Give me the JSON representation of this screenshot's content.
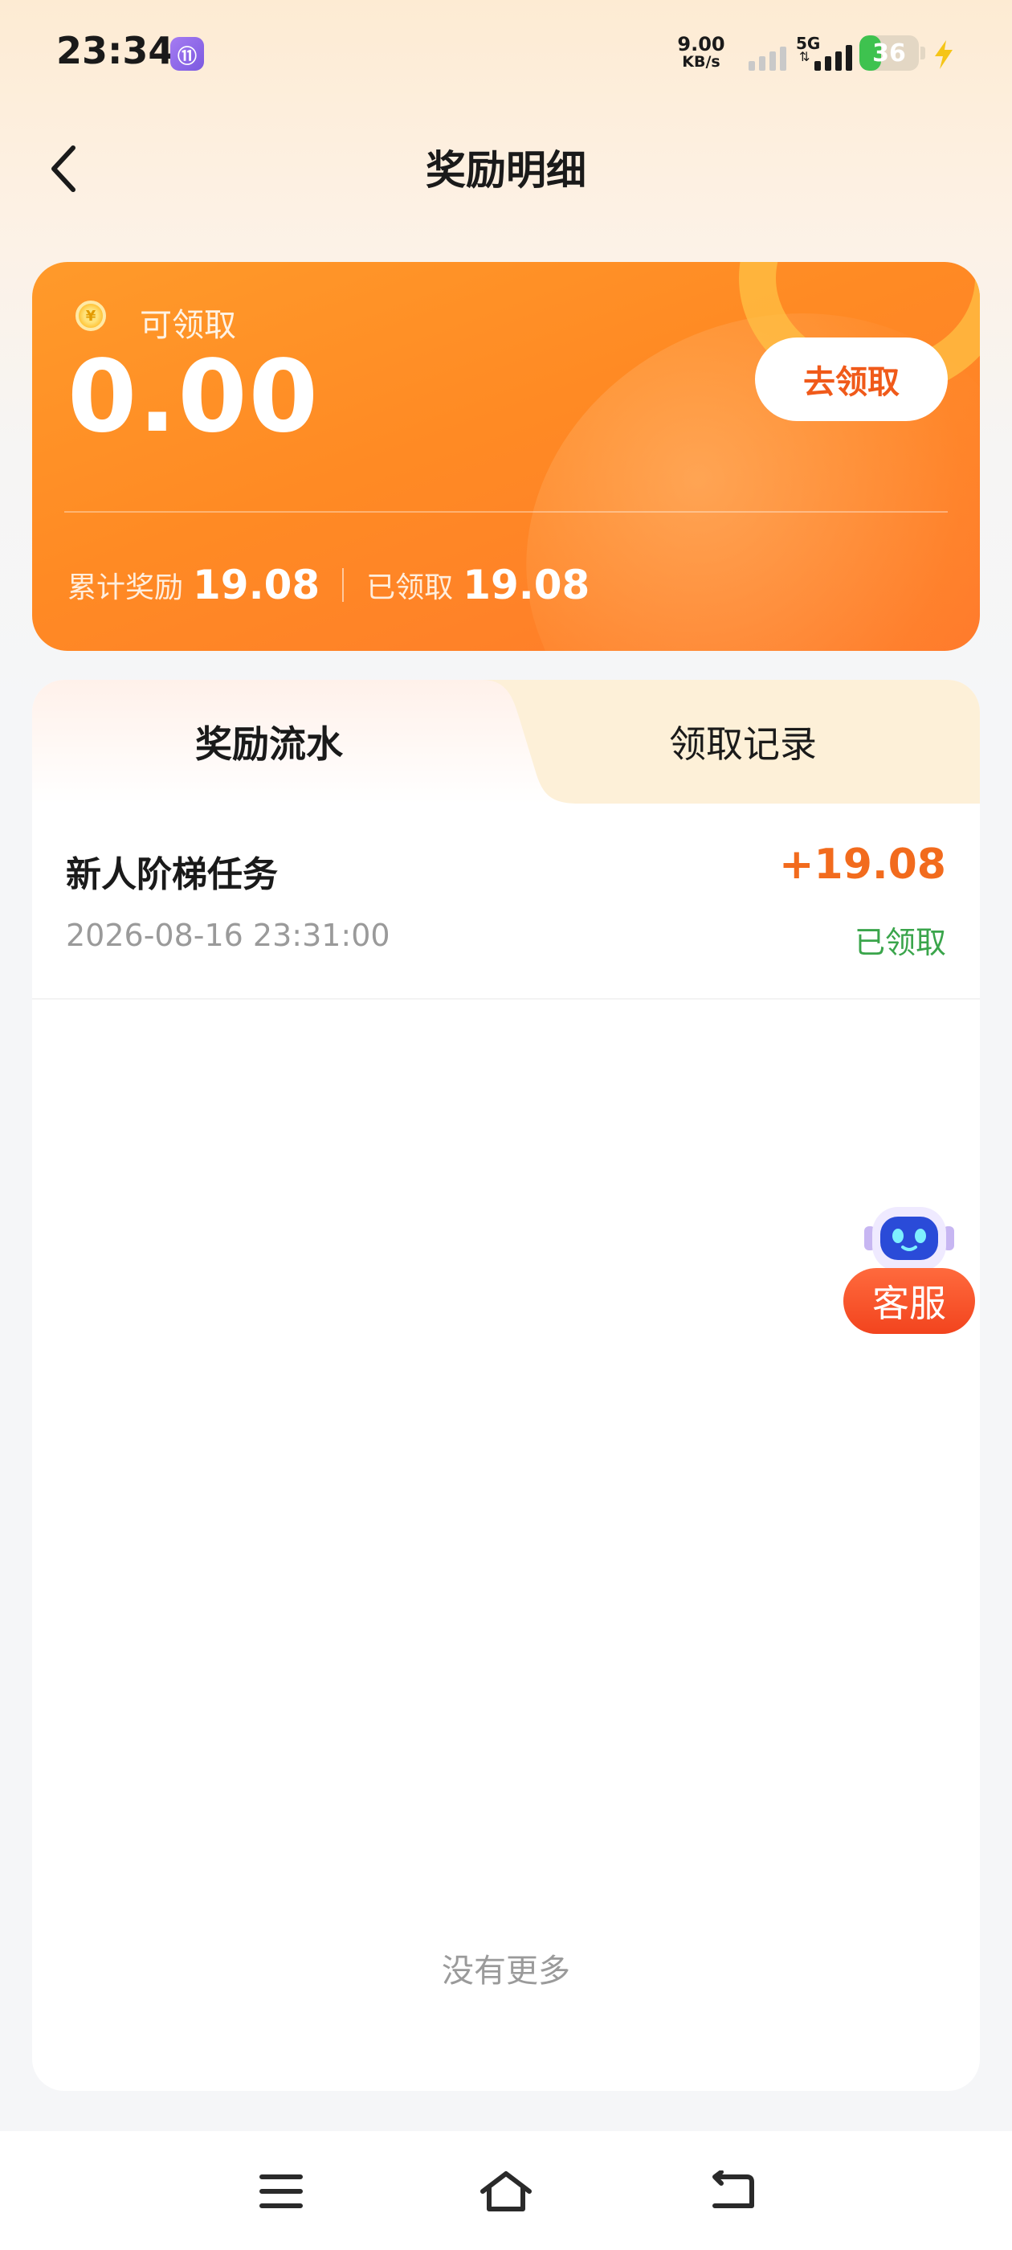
{
  "status_bar": {
    "time": "23:34",
    "app_icon_glyph": "⑪",
    "net_speed_value": "9.00",
    "net_speed_unit": "KB/s",
    "network_type": "5G",
    "battery": "36",
    "battery_level": 0.36
  },
  "header": {
    "title": "奖励明细"
  },
  "reward_card": {
    "coin_glyph": "¥",
    "claimable_label": "可领取",
    "claimable_amount": "0.00",
    "claim_button": "去领取",
    "total_label": "累计奖励",
    "total_value": "19.08",
    "claimed_label": "已领取",
    "claimed_value": "19.08"
  },
  "tabs": [
    {
      "label": "奖励流水",
      "active": true
    },
    {
      "label": "领取记录",
      "active": false
    }
  ],
  "records": [
    {
      "title": "新人阶梯任务",
      "time": "2026-08-16 23:31:00",
      "amount": "+19.08",
      "status": "已领取"
    }
  ],
  "list_footer": "没有更多",
  "service": {
    "label": "客服"
  },
  "icons": {
    "back": "back-arrow-icon",
    "menu": "menu-icon",
    "home": "home-icon",
    "return": "return-icon"
  },
  "colors": {
    "accent_orange": "#ff8a24",
    "amount_orange": "#f26b1d",
    "status_green": "#3aa54b",
    "service_red": "#f2441e"
  }
}
